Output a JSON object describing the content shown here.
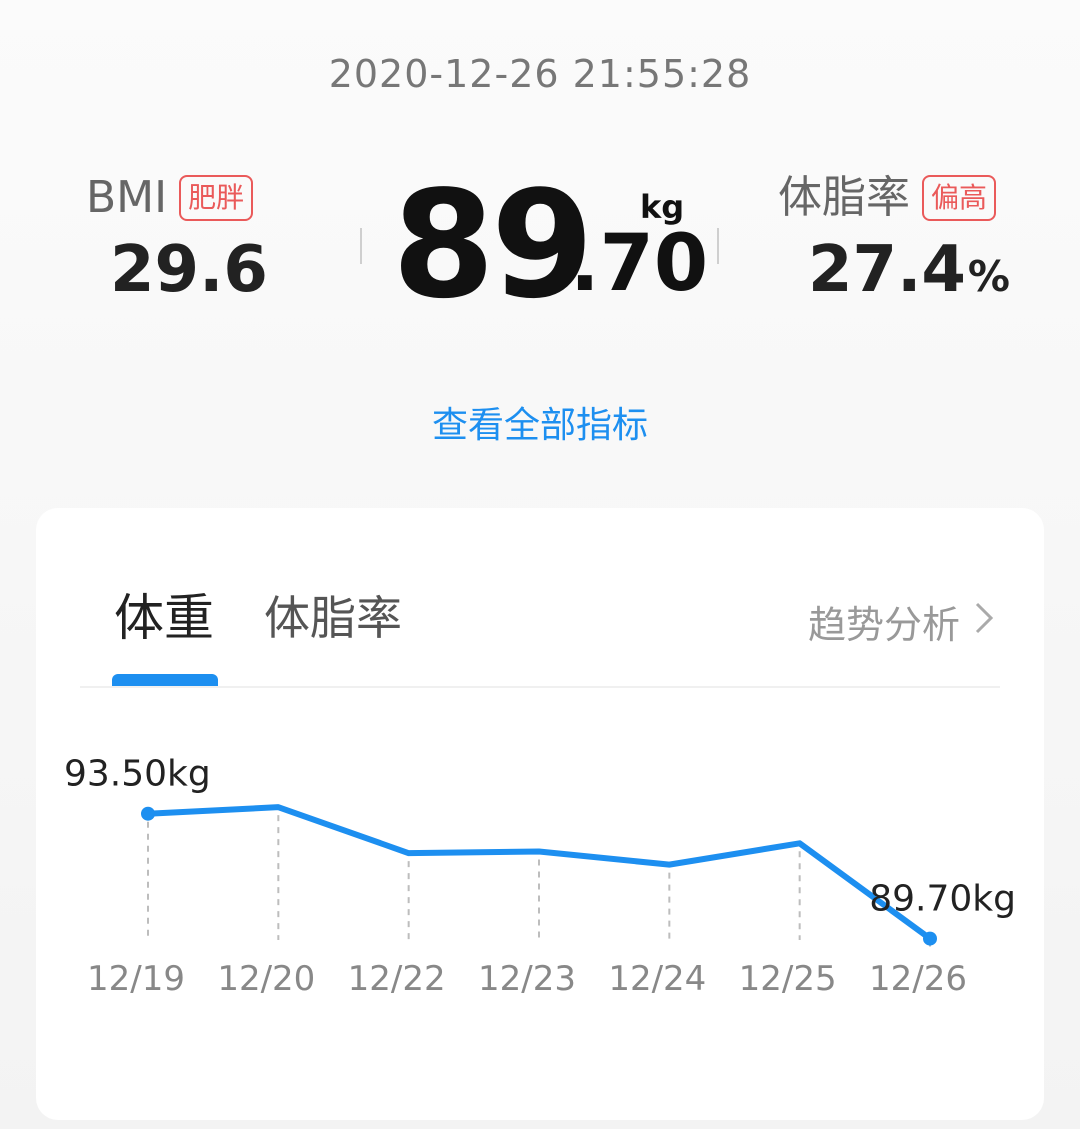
{
  "timestamp": "2020-12-26 21:55:28",
  "bmi": {
    "label": "BMI",
    "status": "肥胖",
    "value": "29.6"
  },
  "weight": {
    "integer": "89",
    "decimal": ".70",
    "unit": "kg"
  },
  "body_fat": {
    "label": "体脂率",
    "status": "偏高",
    "value": "27.4",
    "unit": "%"
  },
  "view_all_label": "查看全部指标",
  "tabs": [
    {
      "label": "体重",
      "active": true
    },
    {
      "label": "体脂率",
      "active": false
    }
  ],
  "trend_label": "趋势分析",
  "colors": {
    "accent": "#1d8ff0",
    "warning": "#ea5a5a"
  },
  "chart_data": {
    "type": "line",
    "categories": [
      "12/19",
      "12/20",
      "12/22",
      "12/23",
      "12/24",
      "12/25",
      "12/26"
    ],
    "series": [
      {
        "values": [
          93.5,
          93.7,
          92.3,
          92.35,
          91.95,
          92.6,
          89.7
        ]
      }
    ],
    "annotations": [
      "93.50kg",
      "89.70kg"
    ],
    "unit": "kg",
    "ylim": [
      88.5,
      95.5
    ],
    "grid": false
  }
}
